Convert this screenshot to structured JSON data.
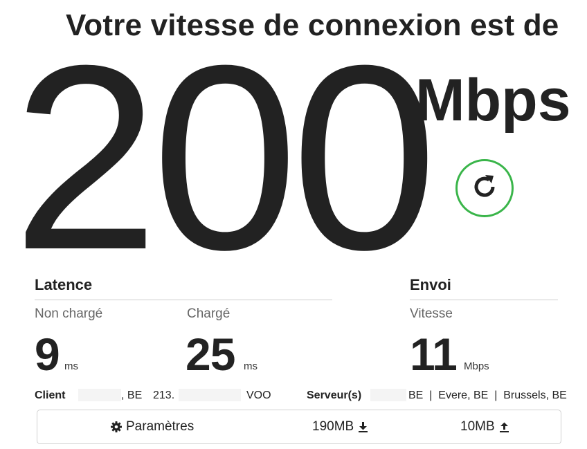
{
  "headline": "Votre vitesse de connexion est de",
  "speed": {
    "value": "200",
    "unit": "Mbps"
  },
  "latency": {
    "title": "Latence",
    "unloaded": {
      "label": "Non chargé",
      "value": "9",
      "unit": "ms"
    },
    "loaded": {
      "label": "Chargé",
      "value": "25",
      "unit": "ms"
    }
  },
  "upload": {
    "title": "Envoi",
    "speed": {
      "label": "Vitesse",
      "value": "11",
      "unit": "Mbps"
    }
  },
  "client": {
    "label": "Client",
    "country": ", BE",
    "ip_partial": "213.",
    "isp": "VOO"
  },
  "servers": {
    "label": "Serveur(s)",
    "list": "BE  |  Evere, BE  |  Brussels, BE"
  },
  "settings_bar": {
    "settings_label": "Paramètres",
    "download_size": "190MB",
    "upload_size": "10MB"
  },
  "colors": {
    "refresh_ring": "#3ab54a",
    "text": "#222222",
    "muted": "#666666"
  },
  "icons": {
    "refresh": "refresh-icon",
    "settings": "gear-icon",
    "download": "download-arrow-icon",
    "upload": "upload-arrow-icon"
  }
}
